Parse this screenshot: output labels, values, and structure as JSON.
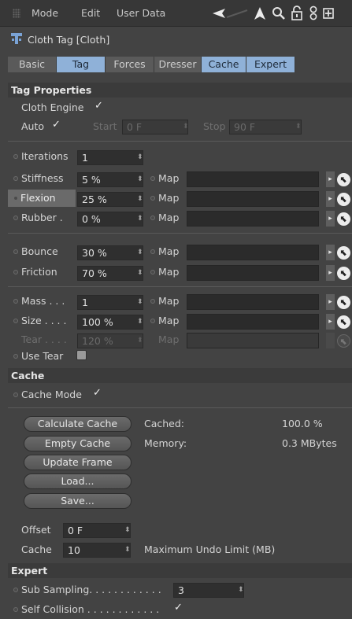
{
  "menubar": {
    "items": [
      "Mode",
      "Edit",
      "User Data"
    ],
    "icons": [
      "back-arrow-icon",
      "up-arrow-icon",
      "search-icon",
      "lock-icon",
      "link-icon",
      "new-window-icon"
    ]
  },
  "title": "Cloth Tag [Cloth]",
  "tabs": [
    {
      "label": "Basic",
      "active": false
    },
    {
      "label": "Tag",
      "active": true
    },
    {
      "label": "Forces",
      "active": false
    },
    {
      "label": "Dresser",
      "active": false
    },
    {
      "label": "Cache",
      "active": true
    },
    {
      "label": "Expert",
      "active": true
    }
  ],
  "tag_properties": {
    "header": "Tag Properties",
    "cloth_engine_label": "Cloth Engine",
    "auto_label": "Auto",
    "start_label": "Start",
    "start_value": "0 F",
    "stop_label": "Stop",
    "stop_value": "90 F",
    "iterations_label": "Iterations",
    "iterations_value": "1",
    "map_label": "Map",
    "params": [
      {
        "label": "Stiffness",
        "value": "5 %"
      },
      {
        "label": "Flexion",
        "value": "25 %"
      },
      {
        "label": "Rubber .",
        "value": "0 %"
      },
      {
        "label": "Bounce",
        "value": "30 %"
      },
      {
        "label": "Friction",
        "value": "70 %"
      },
      {
        "label": "Mass . . .",
        "value": "1"
      },
      {
        "label": "Size . . . .",
        "value": "100 %"
      },
      {
        "label": "Tear . . . .",
        "value": "120 %"
      }
    ],
    "use_tear_label": "Use Tear"
  },
  "cache": {
    "header": "Cache",
    "cache_mode_label": "Cache Mode",
    "buttons": [
      "Calculate Cache",
      "Empty Cache",
      "Update Frame",
      "Load...",
      "Save..."
    ],
    "cached_label": "Cached:",
    "cached_value": "100.0 %",
    "memory_label": "Memory:",
    "memory_value": "0.3 MBytes",
    "offset_label": "Offset",
    "offset_value": "0 F",
    "cache_label": "Cache",
    "cache_value": "10",
    "max_undo_label": "Maximum Undo Limit (MB)"
  },
  "expert": {
    "header": "Expert",
    "sub_sampling_label": "Sub Sampling. . . . . . . . . . . .",
    "sub_sampling_value": "3",
    "self_collision_label": "Self Collision . . . . . . . . . . . ."
  },
  "glyphs": {
    "check": "✓",
    "spin": "⬍",
    "map_arrow": "▸",
    "map_pick": "⬉"
  },
  "colors": {
    "background": "#434343",
    "tab_active": "#8fb1d8",
    "field": "#2f2f2f"
  }
}
